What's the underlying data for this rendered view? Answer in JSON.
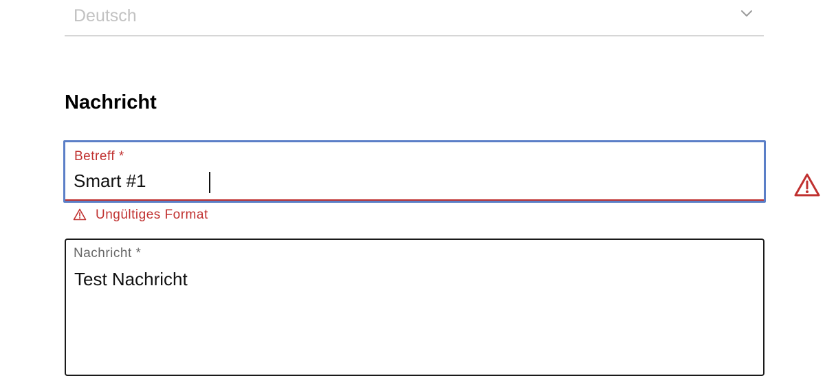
{
  "language_select": {
    "value": "Deutsch",
    "icon": "chevron-down-icon"
  },
  "section": {
    "title": "Nachricht"
  },
  "subject": {
    "label": "Betreff *",
    "value": "Smart #1",
    "status_icon": "warning-icon",
    "error_icon": "warning-icon",
    "error_message": "Ungültiges Format"
  },
  "message": {
    "label": "Nachricht *",
    "value": "Test Nachricht"
  },
  "colors": {
    "error": "#c0302f",
    "focus_border": "#5b7fc7",
    "placeholder_gray": "#c2c2c2"
  }
}
